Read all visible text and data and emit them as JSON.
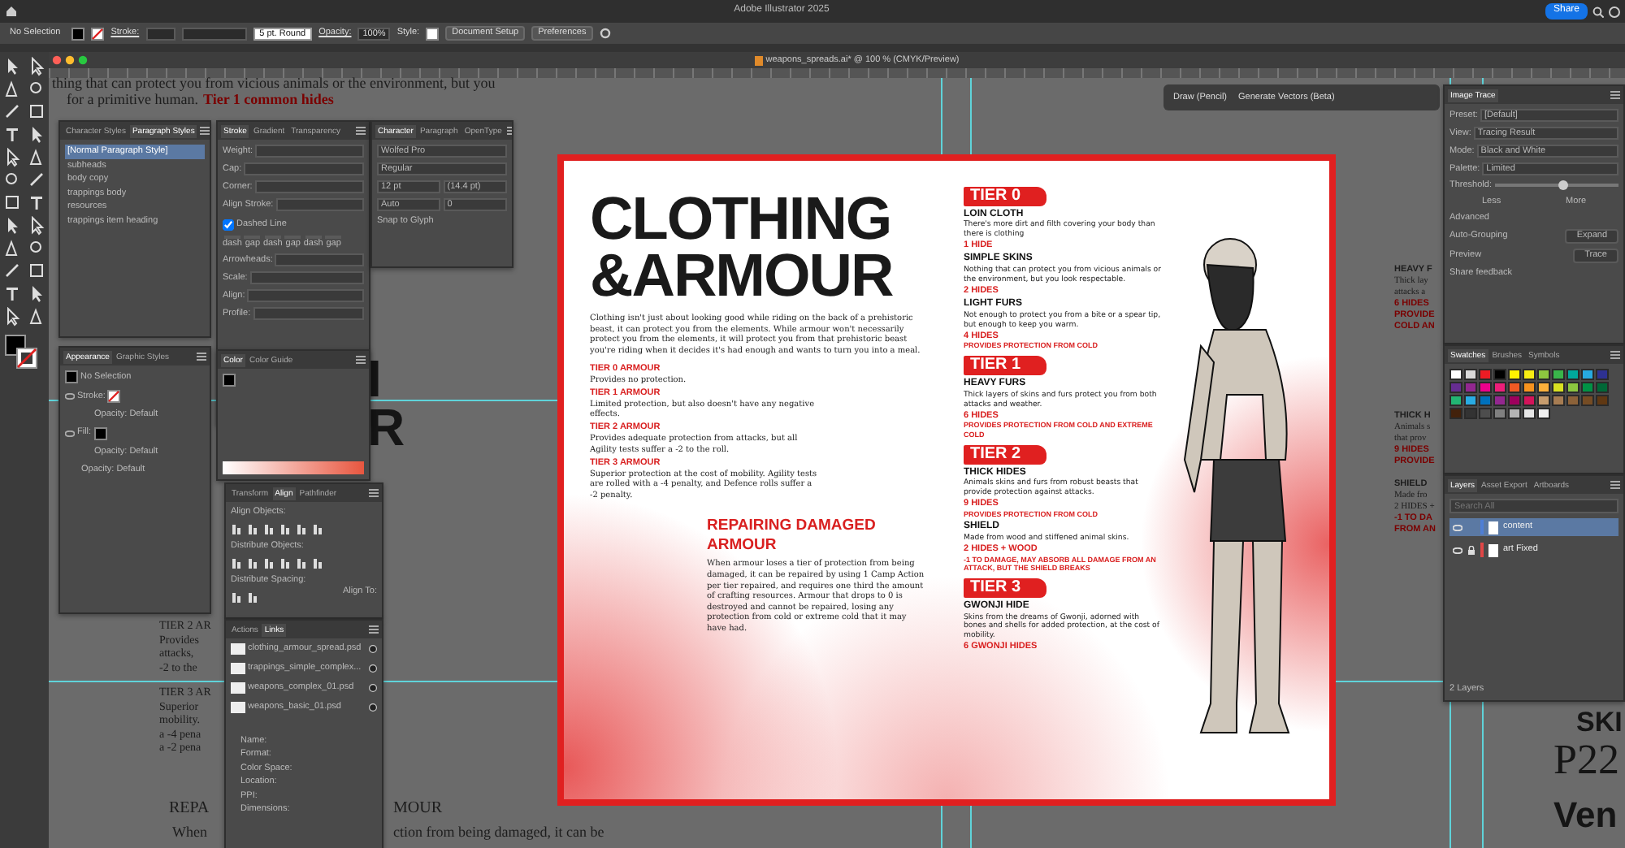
{
  "app_bar": {
    "title": "Adobe Illustrator 2025",
    "share": "Share"
  },
  "control_bar": {
    "selection": "No Selection",
    "stroke_label": "Stroke:",
    "brush": "5 pt. Round",
    "opacity_label": "Opacity:",
    "opacity": "100%",
    "style_label": "Style:",
    "buttons": [
      "Document Setup",
      "Preferences"
    ]
  },
  "document": {
    "title": "weapons_spreads.ai* @ 100 % (CMYK/Preview)"
  },
  "draw_toolbar": {
    "buttons": [
      "Draw (Pencil)",
      "Generate Vectors (Beta)"
    ]
  },
  "background_text": {
    "top_lines": [
      {
        "text": "thing that can protect you from vicious animals or the environment, but you",
        "kind": "body"
      },
      {
        "text": "for a primitive human.",
        "kind": "body"
      },
      {
        "text": "Tier 1 common hides",
        "kind": "note"
      }
    ],
    "big_letters": [
      "I",
      "R"
    ],
    "lower_left": [
      "TIER 2 AR",
      "Provides",
      "attacks,",
      "-2 to the",
      "TIER 3 AR",
      "Superior",
      "mobility.",
      "a -4 pena",
      "a -2 pena"
    ],
    "lower_heading": [
      "REPA",
      "MOUR"
    ],
    "lower_body": [
      "When",
      "ction from being damaged, it can be"
    ],
    "right_groups": [
      [
        "HEAVY F",
        "Thick lay",
        "attacks a",
        "6 HIDES",
        "PROVIDE",
        "COLD AN"
      ],
      [
        "THICK H",
        "Animals s",
        "that prov",
        "9 HIDES",
        "PROVIDE"
      ],
      [
        "SHIELD",
        "Made fro",
        "2 HIDES +",
        "-1 TO DA",
        "FROM AN"
      ]
    ],
    "corner": [
      "SKI",
      "P22",
      "Ven"
    ]
  },
  "artboard": {
    "title_lines": [
      "CLOTHING",
      "&ARMOUR"
    ],
    "intro": "Clothing isn't just about looking good while riding on the back of a prehistoric beast, it can protect you from the elements. While armour won't necessarily protect you from the elements, it will protect you from that prehistoric beast you're riding when it decides it's had enough and wants to turn you into a meal.",
    "armour_tiers": [
      {
        "heading": "TIER 0 ARMOUR",
        "text": "Provides no protection."
      },
      {
        "heading": "TIER 1 ARMOUR",
        "text": "Limited protection, but also doesn't have any negative effects."
      },
      {
        "heading": "TIER 2 ARMOUR",
        "text": "Provides adequate protection from attacks, but all Agility tests suffer a -2 to the roll."
      },
      {
        "heading": "TIER 3 ARMOUR",
        "text": "Superior protection at the cost of mobility. Agility tests are rolled with a -4 penalty, and Defence rolls suffer a -2 penalty."
      }
    ],
    "repair": {
      "heading": "REPAIRING DAMAGED ARMOUR",
      "text": "When armour loses a tier of protection from being damaged, it can be repaired by using 1 Camp Action per tier repaired, and requires one third the amount of crafting resources. Armour that drops to 0 is destroyed and cannot be repaired, losing any protection from cold or extreme cold that it may have had."
    },
    "clothing_tiers": [
      {
        "label": "TIER 0",
        "items": [
          {
            "name": "LOIN CLOTH",
            "text": "There's more dirt and filth covering your body than there is clothing",
            "cost": "1 HIDE"
          },
          {
            "name": "SIMPLE SKINS",
            "text": "Nothing that can protect you from vicious animals or the environment, but you look respectable.",
            "cost": "2 HIDES"
          },
          {
            "name": "LIGHT FURS",
            "text": "Not enough to protect you from a bite or a spear tip, but enough to keep you warm.",
            "cost": "4 HIDES",
            "note": "PROVIDES PROTECTION FROM COLD"
          }
        ]
      },
      {
        "label": "TIER 1",
        "items": [
          {
            "name": "HEAVY FURS",
            "text": "Thick layers of skins and furs protect you from both attacks and weather.",
            "cost": "6 HIDES",
            "note": "PROVIDES PROTECTION FROM COLD AND EXTREME COLD"
          }
        ]
      },
      {
        "label": "TIER 2",
        "items": [
          {
            "name": "THICK HIDES",
            "text": "Animals skins and furs from robust beasts that provide protection against attacks.",
            "cost": "9 HIDES",
            "note": "PROVIDES PROTECTION FROM COLD"
          },
          {
            "name": "SHIELD",
            "text": "Made from wood and stiffened animal skins.",
            "cost": "2 HIDES + WOOD",
            "note": "-1 TO DAMAGE, MAY ABSORB ALL DAMAGE FROM AN ATTACK, BUT THE SHIELD BREAKS"
          }
        ]
      },
      {
        "label": "TIER 3",
        "items": [
          {
            "name": "GWONJI HIDE",
            "text": "Skins from the dreams of Gwonji, adorned with bones and shells for added protection, at the cost of mobility.",
            "cost": "6 GWONJI HIDES"
          }
        ]
      }
    ]
  },
  "paragraph_styles": {
    "tabs": [
      {
        "label": "Character Styles",
        "selected": false
      },
      {
        "label": "Paragraph Styles",
        "selected": true
      }
    ],
    "items": [
      {
        "label": "[Normal Paragraph Style]",
        "selected": true
      },
      {
        "label": "subheads",
        "selected": false
      },
      {
        "label": "body copy",
        "selected": false
      },
      {
        "label": "trappings body",
        "selected": false
      },
      {
        "label": "resources",
        "selected": false
      },
      {
        "label": "trappings item heading",
        "selected": false
      }
    ]
  },
  "stroke": {
    "tabs": [
      {
        "label": "Stroke",
        "selected": true
      },
      {
        "label": "Gradient",
        "selected": false
      },
      {
        "label": "Transparency",
        "selected": false
      }
    ],
    "rows": [
      "Weight:",
      "Cap:",
      "Corner:",
      "Align Stroke:"
    ],
    "dashed": {
      "label": "Dashed Line",
      "checked": true
    },
    "dash_labels": [
      "dash",
      "gap",
      "dash",
      "gap",
      "dash",
      "gap"
    ],
    "rows2": [
      "Arrowheads:",
      "Scale:",
      "Align:",
      "Profile:"
    ]
  },
  "character": {
    "tabs": [
      {
        "label": "Character",
        "selected": true
      },
      {
        "label": "Paragraph",
        "selected": false
      },
      {
        "label": "OpenType",
        "selected": false
      }
    ],
    "font": "Wolfed Pro",
    "style": "Regular",
    "size": "12 pt",
    "leading": "(14.4 pt)",
    "kerning": "Auto",
    "tracking": "0",
    "snap": "Snap to Glyph"
  },
  "appearance": {
    "tabs": [
      {
        "label": "Appearance",
        "selected": true
      },
      {
        "label": "Graphic Styles",
        "selected": false
      }
    ],
    "rows": [
      {
        "kind": "header",
        "label": "No Selection"
      },
      {
        "kind": "stroke",
        "label": "Stroke:"
      },
      {
        "kind": "sub",
        "label": "Opacity:",
        "value": "Default"
      },
      {
        "kind": "fill",
        "label": "Fill:"
      },
      {
        "kind": "sub",
        "label": "Opacity:",
        "value": "Default"
      },
      {
        "kind": "top",
        "label": "Opacity:",
        "value": "Default"
      }
    ]
  },
  "color": {
    "tabs": [
      {
        "label": "Color",
        "selected": true
      },
      {
        "label": "Color Guide",
        "selected": false
      }
    ]
  },
  "align": {
    "tabs": [
      {
        "label": "Transform",
        "selected": false
      },
      {
        "label": "Align",
        "selected": true
      },
      {
        "label": "Pathfinder",
        "selected": false
      }
    ],
    "sections": [
      "Align Objects:",
      "Distribute Objects:",
      "Distribute Spacing:"
    ],
    "align_to": "Align To:"
  },
  "links": {
    "tabs": [
      {
        "label": "Actions",
        "selected": false
      },
      {
        "label": "Links",
        "selected": true
      }
    ],
    "items": [
      "clothing_armour_spread.psd",
      "trappings_simple_complex...",
      "weapons_complex_01.psd",
      "weapons_basic_01.psd"
    ],
    "info": [
      "Name:",
      "Format:",
      "Color Space:",
      "Location:",
      "PPI:",
      "Dimensions:"
    ]
  },
  "image_trace": {
    "title": "Image Trace",
    "rows": [
      {
        "label": "Preset:",
        "value": "[Default]"
      },
      {
        "label": "View:",
        "value": "Tracing Result"
      },
      {
        "label": "Mode:",
        "value": "Black and White"
      },
      {
        "label": "Palette:",
        "value": "Limited"
      }
    ],
    "threshold": {
      "label": "Threshold:",
      "level": 0.55,
      "less": "Less",
      "more": "More"
    },
    "advanced": "Advanced",
    "actions": [
      {
        "label": "Auto-Grouping",
        "button": "Expand"
      },
      {
        "label": "Preview",
        "button": "Trace"
      }
    ],
    "feedback": "Share feedback"
  },
  "swatches": {
    "tabs": [
      {
        "label": "Swatches",
        "selected": true
      },
      {
        "label": "Brushes",
        "selected": false
      },
      {
        "label": "Symbols",
        "selected": false
      }
    ],
    "colors": [
      {
        "color": "#ffffff"
      },
      {
        "color": "#d9d9d9"
      },
      {
        "color": "#ed1c24"
      },
      {
        "color": "#000000"
      },
      {
        "color": "#fff200"
      },
      {
        "color": "#f7ec13"
      },
      {
        "color": "#8dc63f"
      },
      {
        "color": "#39b54a"
      },
      {
        "color": "#00a99d"
      },
      {
        "color": "#27aae1"
      },
      {
        "color": "#2e3192"
      },
      {
        "color": "#662d91"
      },
      {
        "color": "#92278f"
      },
      {
        "color": "#ec008c"
      },
      {
        "color": "#ed1e79"
      },
      {
        "color": "#f15a24"
      },
      {
        "color": "#f7931e"
      },
      {
        "color": "#fbb03b"
      },
      {
        "color": "#d9e021"
      },
      {
        "color": "#8cc63f"
      },
      {
        "color": "#009245"
      },
      {
        "color": "#006837"
      },
      {
        "color": "#22b573"
      },
      {
        "color": "#29abe2"
      },
      {
        "color": "#0071bc"
      },
      {
        "color": "#93278f"
      },
      {
        "color": "#9e005d"
      },
      {
        "color": "#d4145a"
      },
      {
        "color": "#c69c6d"
      },
      {
        "color": "#a67c52"
      },
      {
        "color": "#8c6239"
      },
      {
        "color": "#754c24"
      },
      {
        "color": "#603813"
      },
      {
        "color": "#42210b"
      },
      {
        "color": "#333333"
      },
      {
        "color": "#4d4d4d"
      },
      {
        "color": "#808080"
      },
      {
        "color": "#b3b3b3"
      },
      {
        "color": "#e6e6e6"
      },
      {
        "color": "#f2f2f2"
      }
    ]
  },
  "layers": {
    "tabs": [
      {
        "label": "Layers",
        "selected": true
      },
      {
        "label": "Asset Export",
        "selected": false
      },
      {
        "label": "Artboards",
        "selected": false
      }
    ],
    "search": {
      "placeholder": "Search All"
    },
    "items": [
      {
        "name": "content",
        "selected": true,
        "locked": false,
        "color": "#4f7fd6"
      },
      {
        "name": "art Fixed",
        "selected": false,
        "locked": true,
        "color": "#e04646"
      }
    ],
    "footer": "2 Layers"
  }
}
